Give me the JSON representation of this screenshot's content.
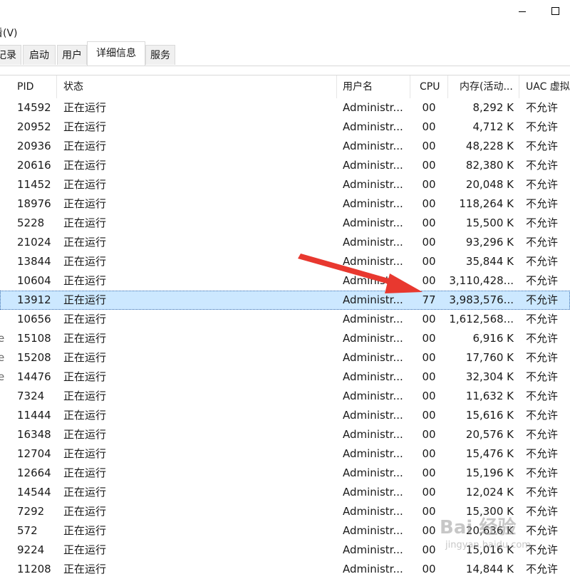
{
  "window": {
    "minimize_icon": "minimize-icon",
    "maximize_icon": "maximize-icon"
  },
  "menu": {
    "view_label": "看(V)"
  },
  "tabs": [
    {
      "label": "记录"
    },
    {
      "label": "启动"
    },
    {
      "label": "用户"
    },
    {
      "label": "详细信息",
      "active": true
    },
    {
      "label": "服务"
    }
  ],
  "columns": {
    "pid": "PID",
    "status": "状态",
    "user": "用户名",
    "cpu": "CPU",
    "memory": "内存(活动...",
    "uac": "UAC 虚拟"
  },
  "rows": [
    {
      "pid": "14592",
      "status": "正在运行",
      "user": "Administr...",
      "cpu": "00",
      "mem": "8,292 K",
      "uac": "不允许"
    },
    {
      "pid": "20952",
      "status": "正在运行",
      "user": "Administr...",
      "cpu": "00",
      "mem": "4,712 K",
      "uac": "不允许"
    },
    {
      "pid": "20936",
      "status": "正在运行",
      "user": "Administr...",
      "cpu": "00",
      "mem": "48,228 K",
      "uac": "不允许"
    },
    {
      "pid": "20616",
      "status": "正在运行",
      "user": "Administr...",
      "cpu": "00",
      "mem": "82,380 K",
      "uac": "不允许"
    },
    {
      "pid": "11452",
      "status": "正在运行",
      "user": "Administr...",
      "cpu": "00",
      "mem": "20,048 K",
      "uac": "不允许"
    },
    {
      "pid": "18976",
      "status": "正在运行",
      "user": "Administr...",
      "cpu": "00",
      "mem": "118,264 K",
      "uac": "不允许"
    },
    {
      "pid": "5228",
      "status": "正在运行",
      "user": "Administr...",
      "cpu": "00",
      "mem": "15,500 K",
      "uac": "不允许"
    },
    {
      "pid": "21024",
      "status": "正在运行",
      "user": "Administr...",
      "cpu": "00",
      "mem": "93,296 K",
      "uac": "不允许"
    },
    {
      "pid": "13844",
      "status": "正在运行",
      "user": "Administr...",
      "cpu": "00",
      "mem": "35,844 K",
      "uac": "不允许"
    },
    {
      "pid": "10604",
      "status": "正在运行",
      "user": "Administr...",
      "cpu": "00",
      "mem": "3,110,428...",
      "uac": "不允许"
    },
    {
      "pid": "13912",
      "status": "正在运行",
      "user": "Administr...",
      "cpu": "77",
      "mem": "3,983,576...",
      "uac": "不允许",
      "selected": true
    },
    {
      "pid": "10656",
      "status": "正在运行",
      "user": "Administr...",
      "cpu": "00",
      "mem": "1,612,568...",
      "uac": "不允许"
    },
    {
      "pid": "15108",
      "status": "正在运行",
      "user": "Administr...",
      "cpu": "00",
      "mem": "6,916 K",
      "uac": "不允许",
      "edge": "e"
    },
    {
      "pid": "15208",
      "status": "正在运行",
      "user": "Administr...",
      "cpu": "00",
      "mem": "17,760 K",
      "uac": "不允许",
      "edge": "e"
    },
    {
      "pid": "14476",
      "status": "正在运行",
      "user": "Administr...",
      "cpu": "00",
      "mem": "32,304 K",
      "uac": "不允许",
      "edge": "e"
    },
    {
      "pid": "7324",
      "status": "正在运行",
      "user": "Administr...",
      "cpu": "00",
      "mem": "11,632 K",
      "uac": "不允许"
    },
    {
      "pid": "11444",
      "status": "正在运行",
      "user": "Administr...",
      "cpu": "00",
      "mem": "15,616 K",
      "uac": "不允许"
    },
    {
      "pid": "16348",
      "status": "正在运行",
      "user": "Administr...",
      "cpu": "00",
      "mem": "20,576 K",
      "uac": "不允许"
    },
    {
      "pid": "12704",
      "status": "正在运行",
      "user": "Administr...",
      "cpu": "00",
      "mem": "15,476 K",
      "uac": "不允许"
    },
    {
      "pid": "12664",
      "status": "正在运行",
      "user": "Administr...",
      "cpu": "00",
      "mem": "15,196 K",
      "uac": "不允许"
    },
    {
      "pid": "14544",
      "status": "正在运行",
      "user": "Administr...",
      "cpu": "00",
      "mem": "12,024 K",
      "uac": "不允许"
    },
    {
      "pid": "7292",
      "status": "正在运行",
      "user": "Administr...",
      "cpu": "00",
      "mem": "15,300 K",
      "uac": "不允许"
    },
    {
      "pid": "572",
      "status": "正在运行",
      "user": "Administr...",
      "cpu": "00",
      "mem": "20,636 K",
      "uac": "不允许"
    },
    {
      "pid": "9224",
      "status": "正在运行",
      "user": "Administr...",
      "cpu": "00",
      "mem": "15,016 K",
      "uac": "不允许"
    },
    {
      "pid": "11208",
      "status": "正在运行",
      "user": "Administr...",
      "cpu": "00",
      "mem": "14,844 K",
      "uac": "不允许"
    }
  ],
  "annotation": {
    "arrow_color": "#e8382f"
  },
  "watermark": {
    "main": "Bai 经验",
    "sub": "jingyan.baidu.com"
  },
  "colors": {
    "selection": "#cce8ff",
    "border": "#d9d9d9"
  }
}
